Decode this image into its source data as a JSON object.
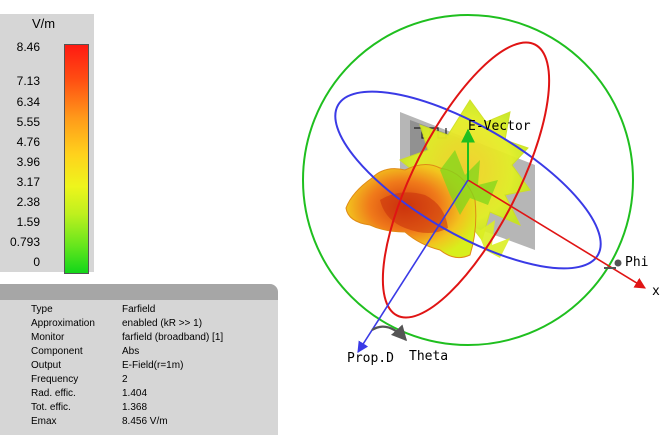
{
  "legend": {
    "unit": "V/m",
    "ticks": [
      "8.46",
      "7.13",
      "6.34",
      "5.55",
      "4.76",
      "3.96",
      "3.17",
      "2.38",
      "1.59",
      "0.793",
      "0"
    ]
  },
  "info": {
    "rows": [
      {
        "key": "Type",
        "value": "Farfield"
      },
      {
        "key": "Approximation",
        "value": "enabled (kR >> 1)"
      },
      {
        "key": "Monitor",
        "value": "farfield (broadband) [1]"
      },
      {
        "key": "Component",
        "value": "Abs"
      },
      {
        "key": "Output",
        "value": "E-Field(r=1m)"
      },
      {
        "key": "Frequency",
        "value": "2"
      },
      {
        "key": "Rad. effic.",
        "value": "1.404"
      },
      {
        "key": "Tot. effic.",
        "value": "1.368"
      },
      {
        "key": "Emax",
        "value": "8.456 V/m"
      }
    ]
  },
  "scene": {
    "labels": {
      "e_vector": "E-Vector",
      "phi": "Phi",
      "x_axis": "x",
      "prop_dir": "Prop.D",
      "theta": "Theta"
    },
    "colors": {
      "sphere": "#1fbf1f",
      "phi_circle": "#3a3ae6",
      "theta_circle": "#e01414"
    }
  }
}
